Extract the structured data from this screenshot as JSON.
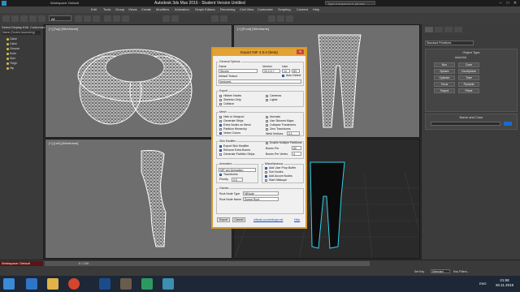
{
  "titlebar": {
    "workspace": "Workspace: Default",
    "title": "Autodesk 3ds Max 2016 - Student Version   Untitled",
    "search_placeholder": "Type a keyword or phrase",
    "minimize": "–",
    "maximize": "□",
    "close": "✕"
  },
  "menubar": {
    "items": [
      "Edit",
      "Tools",
      "Group",
      "Views",
      "Create",
      "Modifiers",
      "Animation",
      "Graph Editors",
      "Rendering",
      "Civil View",
      "Customize",
      "Scripting",
      "Content",
      "Help"
    ]
  },
  "toolbar": {
    "selection_set": "All"
  },
  "scene_explorer": {
    "tabs": [
      "Select",
      "Display",
      "Edit",
      "Customize"
    ],
    "filter": "Name (Sorted Ascending)",
    "items": [
      "Calve",
      "Calve",
      "Closure",
      "Knee",
      "Shin",
      "Thigh",
      "Hip"
    ]
  },
  "viewports": {
    "top": "[+] [Top] [Wireframe]",
    "front": "[+] [Front] [Wireframe]",
    "left": "[+] [Left] [Wireframe]",
    "perspective": "[+] [Perspective] [Realistic]"
  },
  "command_panel": {
    "category": "Standard Primitives",
    "section": "Object Type",
    "autogrid": "AutoGrid",
    "buttons": [
      "Box",
      "Cone",
      "Sphere",
      "GeoSphere",
      "Cylinder",
      "Tube",
      "Torus",
      "Pyramid",
      "Teapot",
      "Plane"
    ],
    "name_section": "Name and Color"
  },
  "status": {
    "workspace": "Workspace: Default",
    "frame": "0 / 100",
    "selected": "Selected",
    "set_key": "Set Key",
    "key_filters": "Key Filters..."
  },
  "taskbar": {
    "time": "21:58",
    "date": "28.11.2015",
    "lang": "ENG"
  },
  "dialog": {
    "title": "Export NIF 4.0.0 (beta)",
    "general_options": "General Options",
    "game_label": "Game",
    "game_value": "Skyrim",
    "version_label": "Version",
    "version_value": "20.2.0.7",
    "user_label": "User",
    "user_value": "12",
    "user2_value": "83",
    "auto_detect": "Auto Detect",
    "default_texture": "Default Texture",
    "texture_path": "textures\\",
    "export_group": "Export",
    "export_items": [
      {
        "label": "Hidden Nodes",
        "checked": false
      },
      {
        "label": "Skeleton Only",
        "checked": false
      },
      {
        "label": "Collision",
        "checked": false
      }
    ],
    "export_right": [
      {
        "label": "Cameras",
        "checked": false
      },
      {
        "label": "Lights",
        "checked": false
      }
    ],
    "mesh_group": "Mesh",
    "mesh_left": [
      {
        "label": "Hide in Viewport",
        "checked": false
      },
      {
        "label": "Generate Strips",
        "checked": false
      },
      {
        "label": "Extra Nodes on Mesh",
        "checked": true
      },
      {
        "label": "Partition Hierarchy",
        "checked": false
      },
      {
        "label": "Vertex Colors",
        "checked": true
      }
    ],
    "mesh_right": [
      {
        "label": "Normals",
        "checked": false
      },
      {
        "label": "Use Skinned Maps",
        "checked": false
      },
      {
        "label": "Collapse Transforms",
        "checked": false
      },
      {
        "label": "Zero Transforms",
        "checked": false
      }
    ],
    "weld_label": "Weld Vertices",
    "weld_value": "0.1",
    "skin_group": "Skin Modifier",
    "skin_left": [
      {
        "label": "Export Skin Modifier",
        "checked": true
      },
      {
        "label": "Remove Extra Bones",
        "checked": true
      },
      {
        "label": "Generate Partition Strips",
        "checked": false
      }
    ],
    "skin_right_label": "Enable Multiple Partitions",
    "bones_part_label": "Bones Per",
    "bones_part_value": "60",
    "bones_vert_label": "Bones Per Vertex",
    "bones_vert_value": "4",
    "anim_group": "Animation",
    "anim_value": "NIF w/o Animation",
    "transforms": "Transforms",
    "priority_label": "Priority",
    "priority_value": "0.0",
    "misc_group": "Miscellaneous",
    "misc_items": [
      {
        "label": "Add User Prop Buffer",
        "checked": true
      },
      {
        "label": "Sort Nodes",
        "checked": false
      },
      {
        "label": "Add Accum Nodes",
        "checked": true
      },
      {
        "label": "Start Nifskope",
        "checked": false
      }
    ],
    "games_group": "Games",
    "root_type_label": "Root Node Type",
    "root_type_value": "NiNode",
    "root_name_label": "Root Node Name",
    "root_name_value": "Scene Root",
    "export_btn": "Export",
    "cancel_btn": "Cancel",
    "link": "niftools.sourceforge.net",
    "help": "Help"
  }
}
